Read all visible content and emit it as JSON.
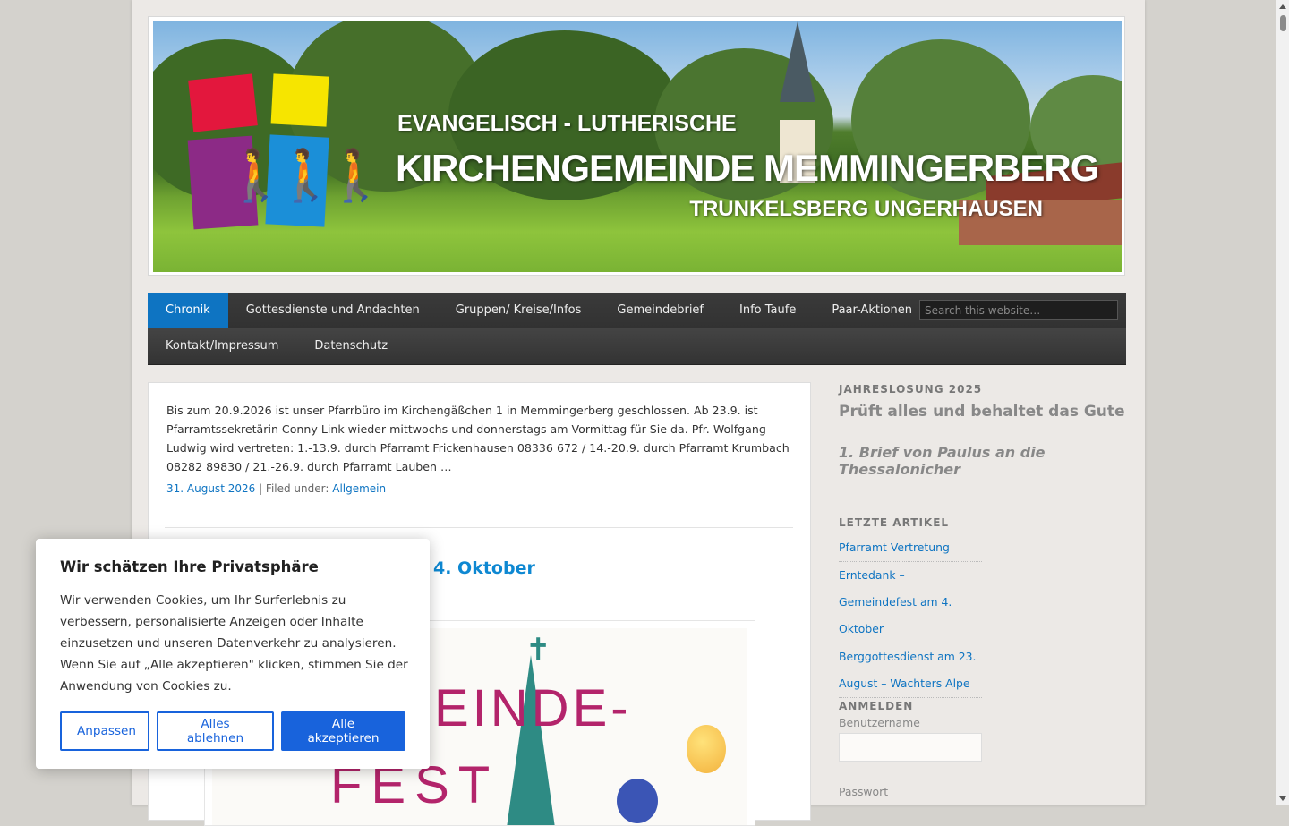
{
  "banner": {
    "line1": "EVANGELISCH - LUTHERISCHE",
    "line2": "KIRCHENGEMEINDE MEMMINGERBERG",
    "line3": "TRUNKELSBERG UNGERHAUSEN"
  },
  "nav": {
    "row1": [
      "Chronik",
      "Gottesdienste und Andachten",
      "Gruppen/ Kreise/Infos",
      "Gemeindebrief",
      "Info Taufe",
      "Paar-Aktionen"
    ],
    "row2": [
      "Kontakt/Impressum",
      "Datenschutz"
    ],
    "active": "Chronik",
    "search_placeholder": "Search this website…"
  },
  "post1": {
    "excerpt": "Bis zum 20.9.2026 ist unser Pfarrbüro im Kirchengäßchen 1 in Memmingerberg geschlossen. Ab 23.9. ist Pfarramtssekretärin Conny Link wieder mittwochs und donnerstags am Vormittag für Sie da. Pfr. Wolfgang Ludwig wird vertreten: 1.-13.9. durch Pfarramt Frickenhausen 08336 672 /  14.-20.9. durch Pfarramt Krumbach 08282 89830 / 21.-26.9. durch Pfarramt Lauben …",
    "date": "31. August 2026",
    "sep": " | Filed under: ",
    "category": "Allgemein"
  },
  "post2": {
    "title_visible": "4. Oktober",
    "flyer_line1": "EINDE-",
    "flyer_line2": "FEST"
  },
  "sidebar": {
    "slogan_title": "JAHRESLOSUNG 2025",
    "slogan_main": "Prüft alles und behaltet das Gute",
    "slogan_ref": "1. Brief von Paulus an die Thessalonicher",
    "recent_title": "LETZTE ARTIKEL",
    "recent": [
      "Pfarramt Vertretung",
      "Erntedank – Gemeindefest am 4. Oktober",
      "Berggottesdienst am 23. August – Wachters Alpe"
    ],
    "login_title": "ANMELDEN",
    "username_label": "Benutzername",
    "password_label": "Passwort"
  },
  "cookie": {
    "title": "Wir schätzen Ihre Privatsphäre",
    "text": "Wir verwenden Cookies, um Ihr Surferlebnis zu verbessern, personalisierte Anzeigen oder Inhalte einzusetzen und unseren Datenverkehr zu analysieren. Wenn Sie auf „Alle akzeptieren\" klicken, stimmen Sie der Anwendung von Cookies zu.",
    "btn_customize": "Anpassen",
    "btn_reject": "Alles ablehnen",
    "btn_accept": "Alle akzeptieren"
  },
  "colors": {
    "accent": "#0e74c2",
    "cookie_blue": "#1863dc",
    "nav_bg": "#333333"
  }
}
